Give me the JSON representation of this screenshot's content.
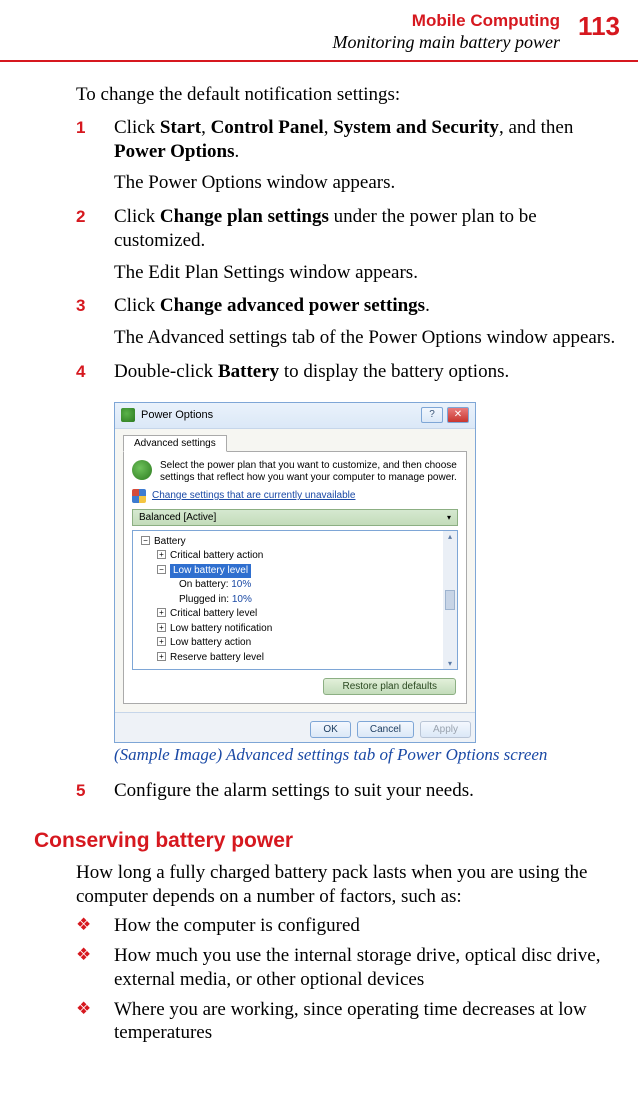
{
  "header": {
    "chapter": "Mobile Computing",
    "section": "Monitoring main battery power",
    "page": "113"
  },
  "intro": "To change the default notification settings:",
  "steps": [
    {
      "num": "1",
      "prefix": "Click ",
      "b1": "Start",
      "s1": ", ",
      "b2": "Control Panel",
      "s2": ", ",
      "b3": "System and Security",
      "s3": ", and then ",
      "b4": "Power Options",
      "suffix": ".",
      "result": "The Power Options window appears."
    },
    {
      "num": "2",
      "prefix": "Click ",
      "b1": "Change plan settings",
      "suffix": " under the power plan to be customized.",
      "result": "The Edit Plan Settings window appears."
    },
    {
      "num": "3",
      "prefix": "Click ",
      "b1": "Change advanced power settings",
      "suffix": ".",
      "result": "The Advanced settings tab of the Power Options window appears."
    },
    {
      "num": "4",
      "prefix": "Double-click ",
      "b1": "Battery",
      "suffix": " to display the battery options."
    },
    {
      "num": "5",
      "text": "Configure the alarm settings to suit your needs."
    }
  ],
  "dialog": {
    "title": "Power Options",
    "tab": "Advanced settings",
    "desc": "Select the power plan that you want to customize, and then choose settings that reflect how you want your computer to manage power.",
    "link": "Change settings that are currently unavailable",
    "plan": "Balanced [Active]",
    "tree": {
      "root": "Battery",
      "items": [
        "Critical battery action",
        "Low battery level",
        "Critical battery level",
        "Low battery notification",
        "Low battery action",
        "Reserve battery level"
      ],
      "sub_on_battery_label": "On battery:",
      "sub_on_battery_value": "10%",
      "sub_plugged_label": "Plugged in:",
      "sub_plugged_value": "10%"
    },
    "restore_btn": "Restore plan defaults",
    "ok": "OK",
    "cancel": "Cancel",
    "apply": "Apply"
  },
  "caption": "(Sample Image) Advanced settings tab of Power Options screen",
  "section2": {
    "heading": "Conserving battery power",
    "para": "How long a fully charged battery pack lasts when you are using the computer depends on a number of factors, such as:",
    "bullets": [
      "How the computer is configured",
      "How much you use the internal storage drive, optical disc drive, external media, or other optional devices",
      "Where you are working, since operating time decreases at low temperatures"
    ]
  },
  "bullet_glyph": "❖"
}
